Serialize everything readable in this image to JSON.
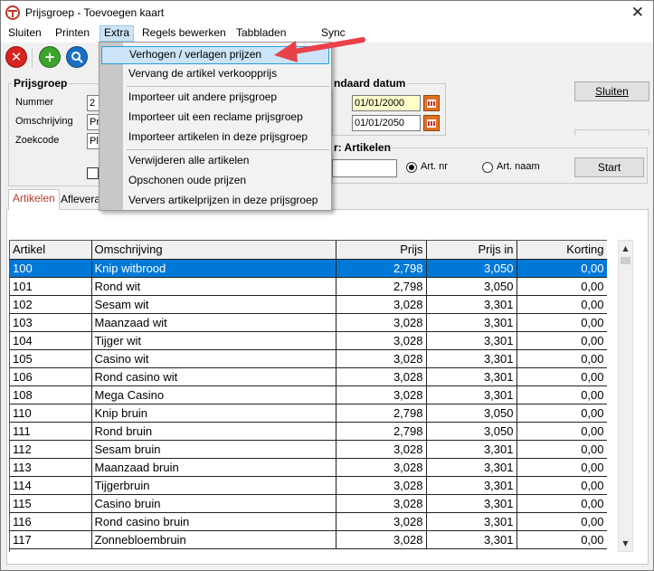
{
  "window": {
    "title": "Prijsgroep - Toevoegen kaart",
    "close_glyph": "✕"
  },
  "menubar": {
    "items": [
      "Sluiten",
      "Printen",
      "Extra",
      "Regels bewerken",
      "Tabbladen",
      "Sync"
    ]
  },
  "toolbar": {
    "icons": [
      "cancel-icon",
      "add-icon",
      "search-icon"
    ]
  },
  "prijsgroep": {
    "title": "Prijsgroep",
    "nummer_label": "Nummer",
    "nummer_value": "2",
    "omschrijving_label": "Omschrijving",
    "omschrijving_value": "Pr",
    "zoekcode_label": "Zoekcode",
    "zoekcode_value": "Pl"
  },
  "standaard_datum": {
    "title": "ndaard datum",
    "from": "01/01/2000",
    "to": "01/01/2050"
  },
  "sluiten_button": "Sluiten",
  "zoek": {
    "title": "r: Artikelen",
    "input_value": "",
    "option_nr": "Art. nr",
    "option_naam": "Art. naam",
    "selected": "Art. nr",
    "start_button": "Start"
  },
  "tabs": {
    "artikelen": "Artikelen",
    "aflevera": "Afleverad"
  },
  "dropdown": {
    "items": [
      "Verhogen / verlagen prijzen",
      "Vervang de artikel verkoopprijs",
      "Importeer uit andere prijsgroep",
      "Importeer uit een reclame prijsgroep",
      "Importeer artikelen in deze prijsgroep",
      "Verwijderen alle artikelen",
      "Opschonen oude prijzen",
      "Ververs artikelprijzen in deze prijsgroep"
    ],
    "highlighted": "Verhogen / verlagen prijzen"
  },
  "grid": {
    "columns": [
      "Artikel",
      "Omschrijving",
      "Prijs",
      "Prijs in",
      "Korting"
    ],
    "rows": [
      [
        "100",
        "Knip witbrood",
        "2,798",
        "3,050",
        "0,00"
      ],
      [
        "101",
        "Rond wit",
        "2,798",
        "3,050",
        "0,00"
      ],
      [
        "102",
        "Sesam wit",
        "3,028",
        "3,301",
        "0,00"
      ],
      [
        "103",
        "Maanzaad wit",
        "3,028",
        "3,301",
        "0,00"
      ],
      [
        "104",
        "Tijger wit",
        "3,028",
        "3,301",
        "0,00"
      ],
      [
        "105",
        "Casino wit",
        "3,028",
        "3,301",
        "0,00"
      ],
      [
        "106",
        "Rond casino wit",
        "3,028",
        "3,301",
        "0,00"
      ],
      [
        "108",
        "Mega Casino",
        "3,028",
        "3,301",
        "0,00"
      ],
      [
        "110",
        "Knip bruin",
        "2,798",
        "3,050",
        "0,00"
      ],
      [
        "111",
        "Rond bruin",
        "2,798",
        "3,050",
        "0,00"
      ],
      [
        "112",
        "Sesam bruin",
        "3,028",
        "3,301",
        "0,00"
      ],
      [
        "113",
        "Maanzaad bruin",
        "3,028",
        "3,301",
        "0,00"
      ],
      [
        "114",
        "Tijgerbruin",
        "3,028",
        "3,301",
        "0,00"
      ],
      [
        "115",
        "Casino bruin",
        "3,028",
        "3,301",
        "0,00"
      ],
      [
        "116",
        "Rond casino bruin",
        "3,028",
        "3,301",
        "0,00"
      ],
      [
        "117",
        "Zonnebloembruin",
        "3,028",
        "3,301",
        "0,00"
      ]
    ],
    "selected_row": "100"
  },
  "colors": {
    "selection": "#0078d7",
    "menu_highlight": "#cce4f7",
    "arrow": "#e8414a",
    "date_field": "#ffffcc"
  }
}
